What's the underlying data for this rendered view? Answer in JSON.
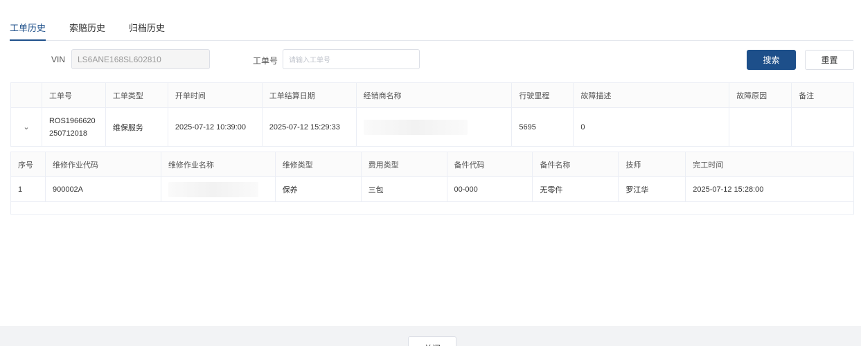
{
  "tabs": [
    {
      "label": "工单历史"
    },
    {
      "label": "索赔历史"
    },
    {
      "label": "归档历史"
    }
  ],
  "search": {
    "vin_label": "VIN",
    "vin_value": "LS6ANE168SL602810",
    "order_label": "工单号",
    "order_placeholder": "请输入工单号",
    "search_button": "搜索",
    "reset_button": "重置"
  },
  "orders_table": {
    "columns": [
      "",
      "工单号",
      "工单类型",
      "开单时间",
      "工单结算日期",
      "经销商名称",
      "行驶里程",
      "故障描述",
      "故障原因",
      "备注"
    ],
    "rows": [
      {
        "order_no_line1": "ROS1966620",
        "order_no_line2": "250712018",
        "order_type": "维保服务",
        "open_time": "2025-07-12 10:39:00",
        "settle_date": "2025-07-12 15:29:33",
        "dealer_name": "",
        "mileage": "5695",
        "fault_desc": "0",
        "fault_reason": "",
        "remark": ""
      }
    ]
  },
  "detail_table": {
    "columns": [
      "序号",
      "维修作业代码",
      "维修作业名称",
      "维修类型",
      "费用类型",
      "备件代码",
      "备件名称",
      "技师",
      "完工时间"
    ],
    "rows": [
      {
        "seq": "1",
        "op_code": "900002A",
        "op_name": "",
        "repair_type": "保养",
        "fee_type": "三包",
        "part_code": "00-000",
        "part_name": "无零件",
        "technician": "罗江华",
        "finish_time": "2025-07-12 15:28:00"
      }
    ]
  },
  "footer": {
    "close_button": "关闭"
  },
  "colors": {
    "primary": "#1d4f8a",
    "border": "#ebeef5"
  }
}
